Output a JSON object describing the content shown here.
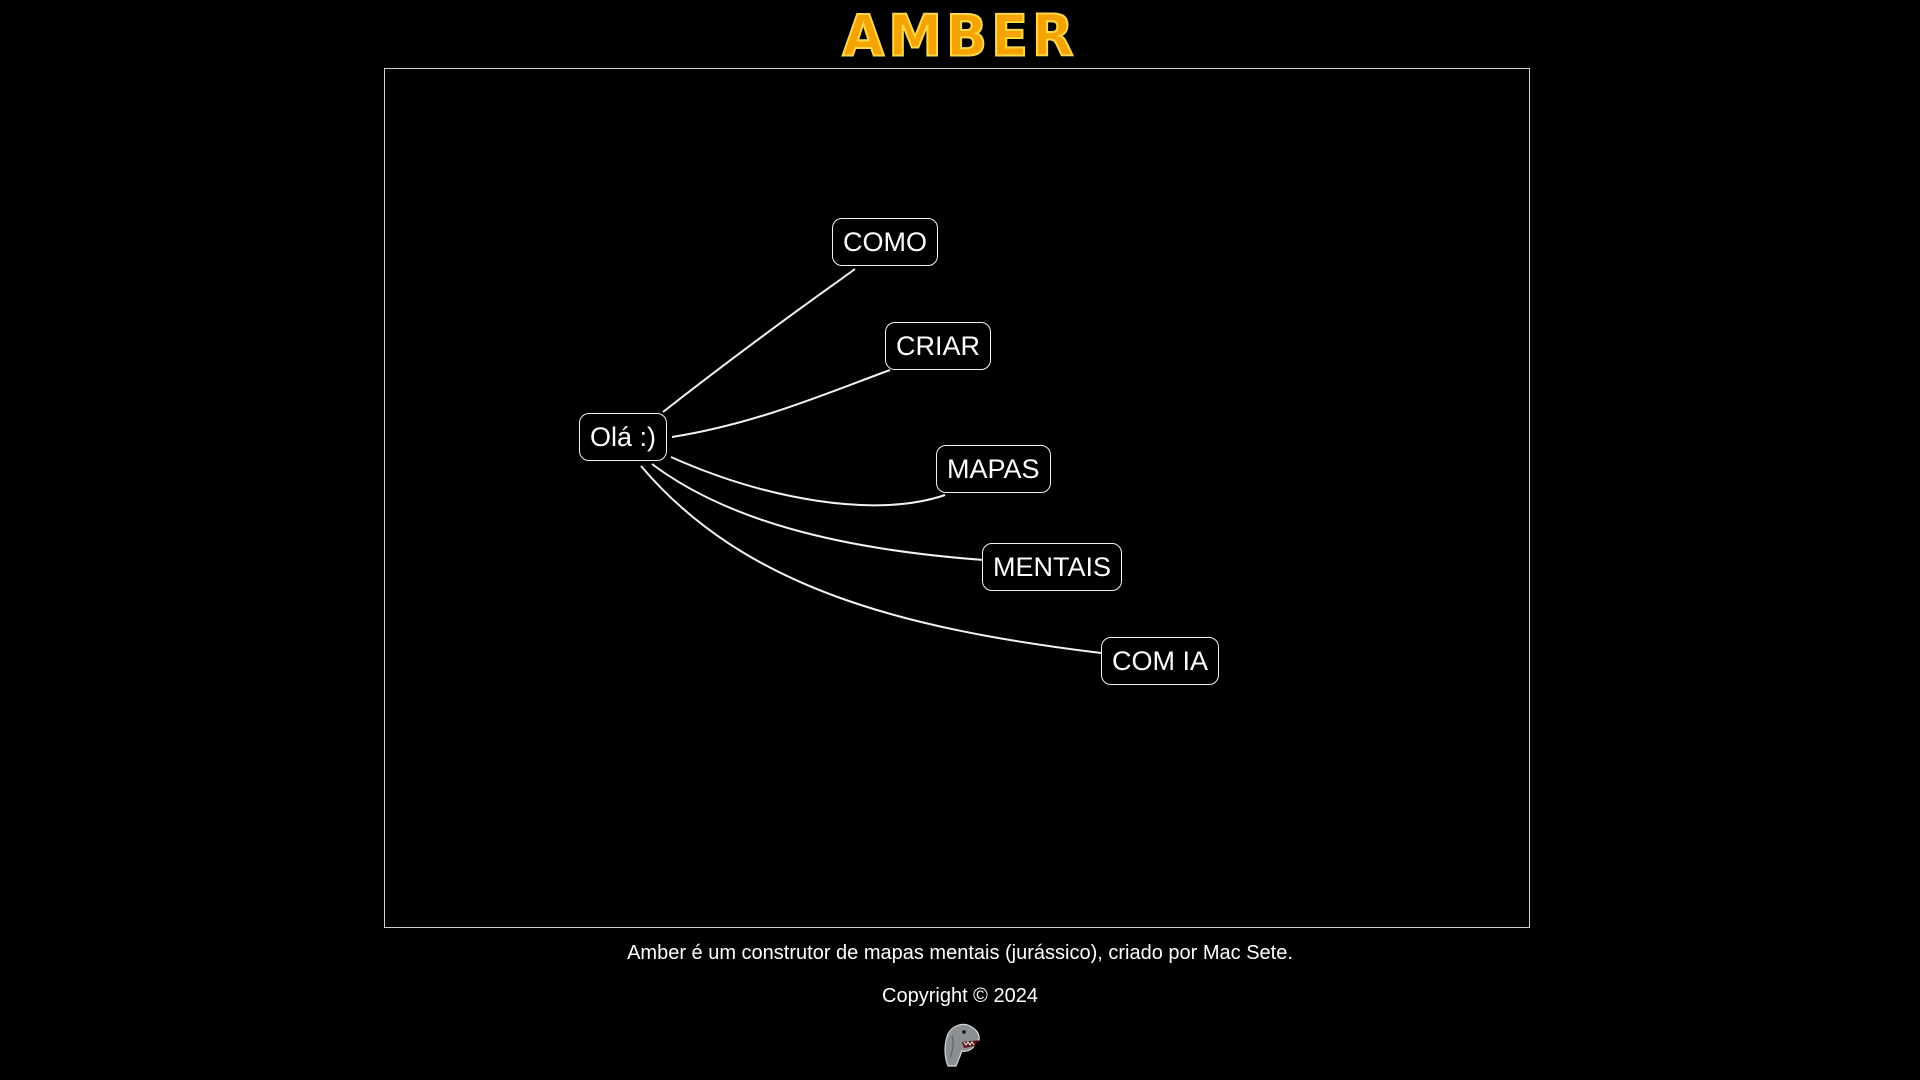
{
  "header": {
    "title": "AMBER",
    "title_color": "#f5a300",
    "title_outline_color": "#ffd84a"
  },
  "mindmap": {
    "root": {
      "label": "Olá :)"
    },
    "children": [
      {
        "label": "COMO"
      },
      {
        "label": "CRIAR"
      },
      {
        "label": "MAPAS"
      },
      {
        "label": "MENTAIS"
      },
      {
        "label": "COM IA"
      }
    ],
    "line_color": "#f2f2f2",
    "border_color": "#cfcfcf"
  },
  "footer": {
    "description": "Amber é um construtor de mapas mentais (jurássico), criado por Mac Sete.",
    "copyright": "Copyright © 2024",
    "mascot_icon": "t-rex-head-icon"
  }
}
